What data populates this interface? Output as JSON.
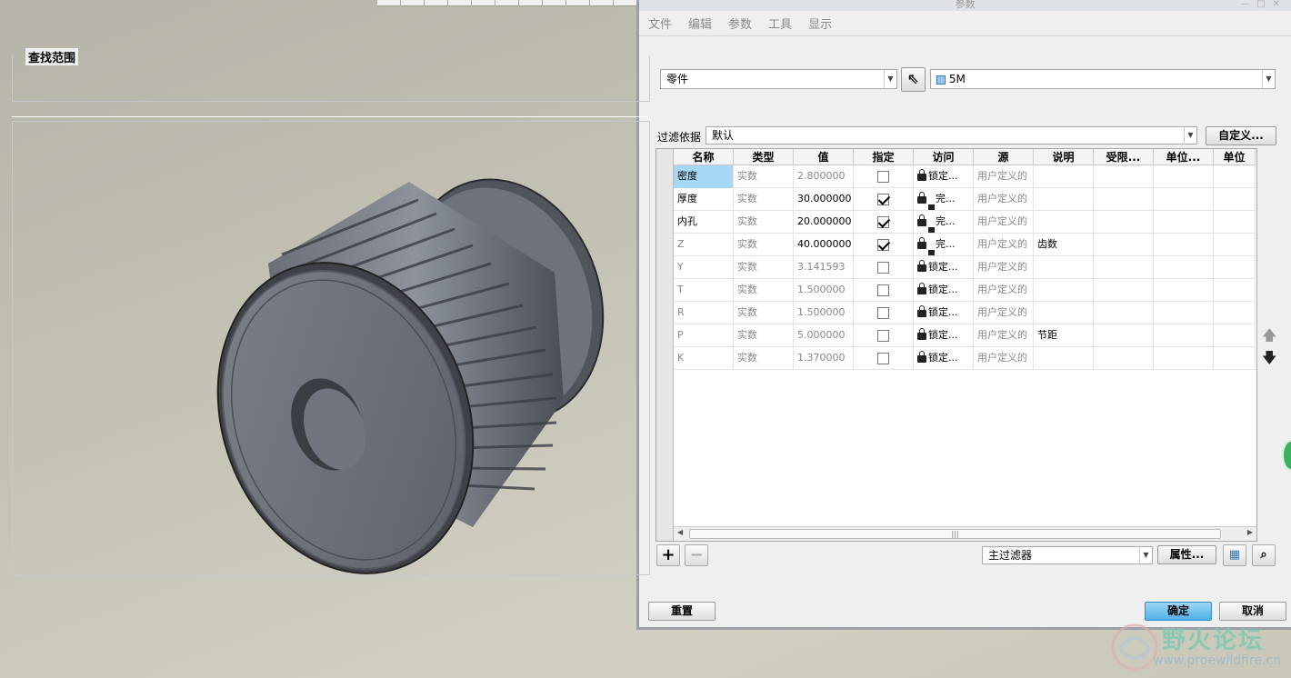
{
  "dialog": {
    "title": "参数",
    "menu": [
      "文件",
      "编辑",
      "参数",
      "工具",
      "显示"
    ],
    "scope": {
      "label": "查找范围",
      "type_value": "零件",
      "object_value": "5M"
    },
    "filter": {
      "label": "过滤依据",
      "value": "默认",
      "customize_label": "自定义..."
    },
    "table": {
      "columns": [
        "名称",
        "类型",
        "值",
        "指定",
        "访问",
        "源",
        "说明",
        "受限...",
        "单位...",
        "单位"
      ],
      "rows": [
        {
          "name": "密度",
          "type": "实数",
          "value": "2.800000",
          "designate": false,
          "access": "锁定...",
          "source": "用户定义的",
          "desc": ""
        },
        {
          "name": "厚度",
          "type": "实数",
          "value": "30.000000",
          "designate": true,
          "access": "完...",
          "source": "用户定义的",
          "desc": ""
        },
        {
          "name": "内孔",
          "type": "实数",
          "value": "20.000000",
          "designate": true,
          "access": "完...",
          "source": "用户定义的",
          "desc": ""
        },
        {
          "name": "Z",
          "type": "实数",
          "value": "40.000000",
          "designate": true,
          "access": "完...",
          "source": "用户定义的",
          "desc": "齿数"
        },
        {
          "name": "Y",
          "type": "实数",
          "value": "3.141593",
          "designate": false,
          "access": "锁定...",
          "source": "用户定义的",
          "desc": ""
        },
        {
          "name": "T",
          "type": "实数",
          "value": "1.500000",
          "designate": false,
          "access": "锁定...",
          "source": "用户定义的",
          "desc": ""
        },
        {
          "name": "R",
          "type": "实数",
          "value": "1.500000",
          "designate": false,
          "access": "锁定...",
          "source": "用户定义的",
          "desc": ""
        },
        {
          "name": "P",
          "type": "实数",
          "value": "5.000000",
          "designate": false,
          "access": "锁定...",
          "source": "用户定义的",
          "desc": "节距"
        },
        {
          "name": "K",
          "type": "实数",
          "value": "1.370000",
          "designate": false,
          "access": "锁定...",
          "source": "用户定义的",
          "desc": ""
        }
      ]
    },
    "bottom": {
      "main_filter": "主过滤器",
      "properties_label": "属性...",
      "reset_label": "重置",
      "ok_label": "确定",
      "cancel_label": "取消"
    }
  },
  "watermark": {
    "text": "野火论坛",
    "url": "www.proewildfire.cn"
  },
  "colors": {
    "accent": "#4fb0e8",
    "selected_cell": "#a6d8f6"
  }
}
